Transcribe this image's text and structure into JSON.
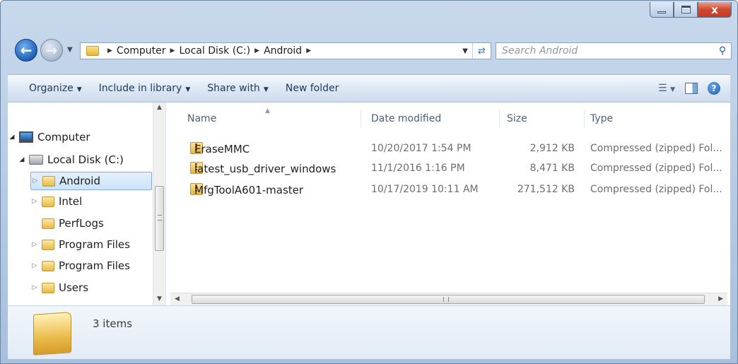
{
  "window": {
    "caption_buttons": {
      "minimize_icon": "minimize-icon",
      "maximize_icon": "maximize-icon",
      "close_glyph": "x"
    }
  },
  "address_bar": {
    "breadcrumbs": [
      "Computer",
      "Local Disk (C:)",
      "Android"
    ]
  },
  "search": {
    "placeholder": "Search Android"
  },
  "command_bar": {
    "organize": "Organize",
    "include_in_library": "Include in library",
    "share_with": "Share with",
    "new_folder": "New folder"
  },
  "nav_tree": {
    "items": [
      {
        "label": "Computer",
        "icon": "computer-icon",
        "level": 0,
        "expanded": true
      },
      {
        "label": "Local Disk (C:)",
        "icon": "disk-icon",
        "level": 1,
        "expanded": true
      },
      {
        "label": "Android",
        "icon": "folder-icon",
        "level": 2,
        "selected": true
      },
      {
        "label": "Intel",
        "icon": "folder-icon",
        "level": 2
      },
      {
        "label": "PerfLogs",
        "icon": "folder-icon",
        "level": 2
      },
      {
        "label": "Program Files",
        "icon": "folder-icon",
        "level": 2
      },
      {
        "label": "Program Files",
        "icon": "folder-icon",
        "level": 2
      },
      {
        "label": "Users",
        "icon": "folder-icon",
        "level": 2
      }
    ]
  },
  "file_list": {
    "columns": {
      "name": "Name",
      "date": "Date modified",
      "size": "Size",
      "type": "Type"
    },
    "rows": [
      {
        "name": "EraseMMC",
        "date": "10/20/2017 1:54 PM",
        "size": "2,912 KB",
        "type": "Compressed (zipped) Fol..."
      },
      {
        "name": "latest_usb_driver_windows",
        "date": "11/1/2016 1:16 PM",
        "size": "8,471 KB",
        "type": "Compressed (zipped) Fol..."
      },
      {
        "name": "MfgToolA601-master",
        "date": "10/17/2019 10:11 AM",
        "size": "271,512 KB",
        "type": "Compressed (zipped) Fol..."
      }
    ]
  },
  "details_pane": {
    "item_count": "3 items"
  },
  "colors": {
    "selection_bg": "#cde4fa",
    "selection_border": "#84acdd",
    "close_button": "#c53b23"
  }
}
